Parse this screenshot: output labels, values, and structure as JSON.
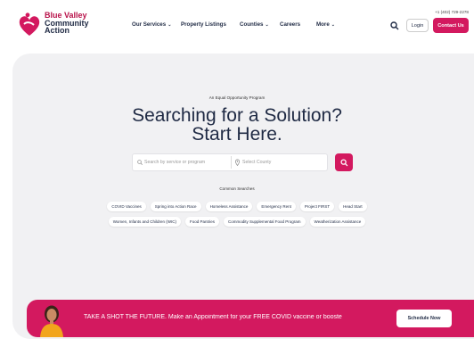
{
  "brand": {
    "line1": "Blue Valley",
    "line2": "Community",
    "line3": "Action",
    "primary_color": "#d3195f",
    "navy_color": "#1f2a44"
  },
  "nav": {
    "items": [
      {
        "label": "Our Services",
        "has_dropdown": true
      },
      {
        "label": "Property Listings",
        "has_dropdown": false
      },
      {
        "label": "Counties",
        "has_dropdown": true
      },
      {
        "label": "Careers",
        "has_dropdown": false
      },
      {
        "label": "More",
        "has_dropdown": true
      }
    ],
    "phone": "+1 (402) 729-2278",
    "login_label": "Login",
    "contact_label": "Contact Us"
  },
  "hero": {
    "eyebrow": "An Equal Opportunity Program",
    "title_line1": "Searching for a Solution?",
    "title_line2": "Start Here.",
    "search_placeholder": "Search by service or program",
    "county_placeholder": "Select County",
    "common_searches_label": "Common Searches",
    "chips": [
      "COVID Vaccines",
      "Spring into Action Race",
      "Homeless Assistance",
      "Emergency Rent",
      "Project FIRST",
      "Head Start",
      "Women, Infants and Children (WIC)",
      "Food Pantries",
      "Commodity Supplemental Food Program",
      "Weatherization Assistance"
    ]
  },
  "banner": {
    "text": "TAKE A SHOT THE FUTURE. Make an Appointment for your FREE COVID vaccine or booste",
    "button_label": "Schedule Now"
  }
}
